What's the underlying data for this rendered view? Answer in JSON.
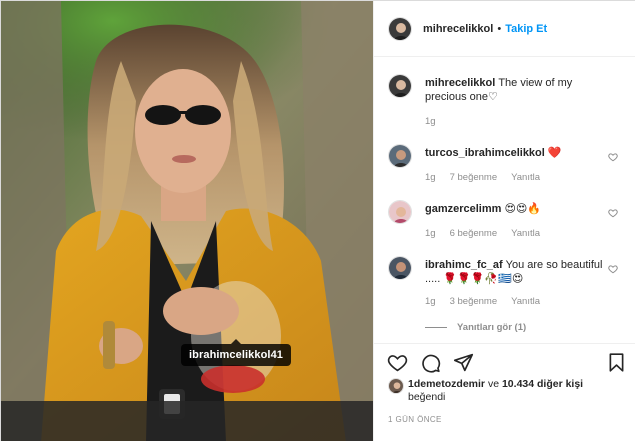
{
  "post": {
    "user_tag": "ibrahimcelikkol41",
    "header": {
      "username": "mihrecelikkol",
      "separator": "•",
      "follow_label": "Takip Et"
    },
    "caption": {
      "username": "mihrecelikkol",
      "text": "The view of my precious one♡",
      "time": "1g"
    },
    "comments": [
      {
        "username": "turcos_ibrahimcelikkol",
        "text": "❤️",
        "time": "1g",
        "likes": "7 beğenme",
        "reply_label": "Yanıtla"
      },
      {
        "username": "gamzercelimm",
        "text": "😍😍🔥",
        "time": "1g",
        "likes": "6 beğenme",
        "reply_label": "Yanıtla"
      },
      {
        "username": "ibrahimc_fc_af",
        "text": "You are so beautiful ..... 🌹🌹🌹🥀🇬🇷😍",
        "time": "1g",
        "likes": "3 beğenme",
        "reply_label": "Yanıtla",
        "view_replies": "Yanıtları gör (1)"
      }
    ],
    "liked_by": {
      "user": "1demetozdemir",
      "connector": " ve ",
      "others": "10.434 diğer kişi",
      "suffix": " beğendi"
    },
    "timestamp": "1 GÜN ÖNCE",
    "colors": {
      "link_blue": "#0095f6",
      "muted_text": "#8e8e8e",
      "heart_red": "#ed4956"
    }
  }
}
